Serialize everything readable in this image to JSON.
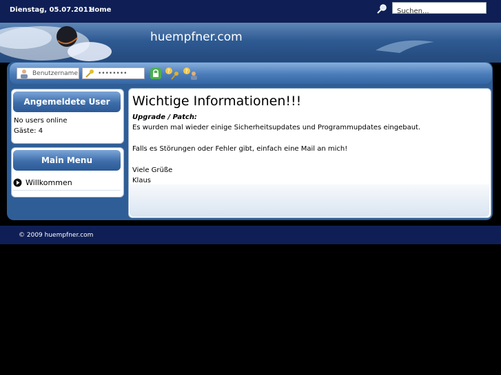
{
  "topbar": {
    "date": "Dienstag, 05.07.2011",
    "home_label": "Home",
    "search_value": "Suchen..."
  },
  "banner": {
    "site_title": "huempfner.com"
  },
  "login": {
    "username_placeholder": "Benutzername",
    "password_value": "••••••••"
  },
  "sidebar": {
    "users_heading": "Angemeldete User",
    "users_online": "No users online",
    "guests": "Gäste: 4",
    "menu_heading": "Main Menu",
    "menu_items": [
      {
        "label": "Willkommen"
      }
    ]
  },
  "main": {
    "title": "Wichtige Informationen!!!",
    "subtitle": "Upgrade / Patch:",
    "line1": "Es wurden mal wieder einige Sicherheitsupdates und Programmupdates eingebaut.",
    "line2": "Falls es Störungen oder Fehler gibt, einfach eine Mail an mich!",
    "line3": "Viele Grüße",
    "line4": "Klaus"
  },
  "footer": {
    "copyright": "© 2009 huempfner.com"
  },
  "colors": {
    "navy": "#0f1f55",
    "blue": "#2f5e97"
  }
}
